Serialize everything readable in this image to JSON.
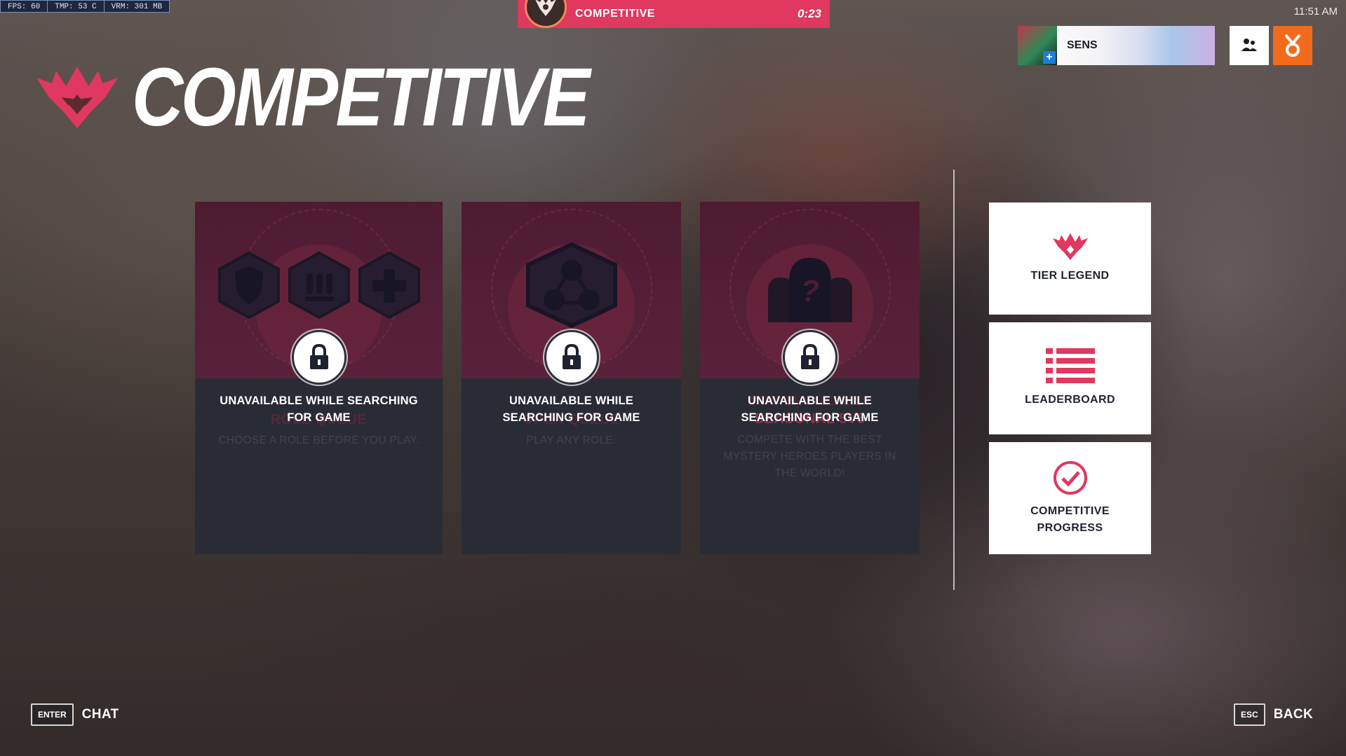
{
  "perf": {
    "fps": "FPS: 60",
    "tmp": "TMP: 53 C",
    "vram": "VRM: 301 MB"
  },
  "clock": "11:51 AM",
  "queue": {
    "title": "COMPETITIVE",
    "timer": "0:23"
  },
  "player": {
    "name": "SENS"
  },
  "header": {
    "title": "COMPETITIVE"
  },
  "modes": [
    {
      "name": "ROLE QUEUE",
      "desc": "CHOOSE A ROLE BEFORE YOU PLAY.",
      "status": "UNAVAILABLE WHILE SEARCHING FOR GAME"
    },
    {
      "name": "OPEN QUEUE",
      "desc": "PLAY ANY ROLE.",
      "status": "UNAVAILABLE WHILE SEARCHING FOR GAME"
    },
    {
      "subtitle": "MYSTERY HEROES",
      "name": "SEASONAL 5V5",
      "desc": "COMPETE WITH THE BEST MYSTERY HEROES PLAYERS IN THE WORLD!",
      "status": "UNAVAILABLE WHILE SEARCHING FOR GAME"
    }
  ],
  "tiles": [
    {
      "label": "TIER LEGEND",
      "icon": "competitive-emblem-icon"
    },
    {
      "label": "LEADERBOARD",
      "icon": "list-icon"
    },
    {
      "label": "COMPETITIVE PROGRESS",
      "icon": "checkmark-circle-icon"
    }
  ],
  "hints": {
    "chat_key": "ENTER",
    "chat_label": "CHAT",
    "back_key": "ESC",
    "back_label": "BACK"
  },
  "colors": {
    "accent": "#e0385e",
    "reward": "#f26b1d",
    "card_bg": "#2d3039",
    "card_art": "#5e1a35"
  }
}
